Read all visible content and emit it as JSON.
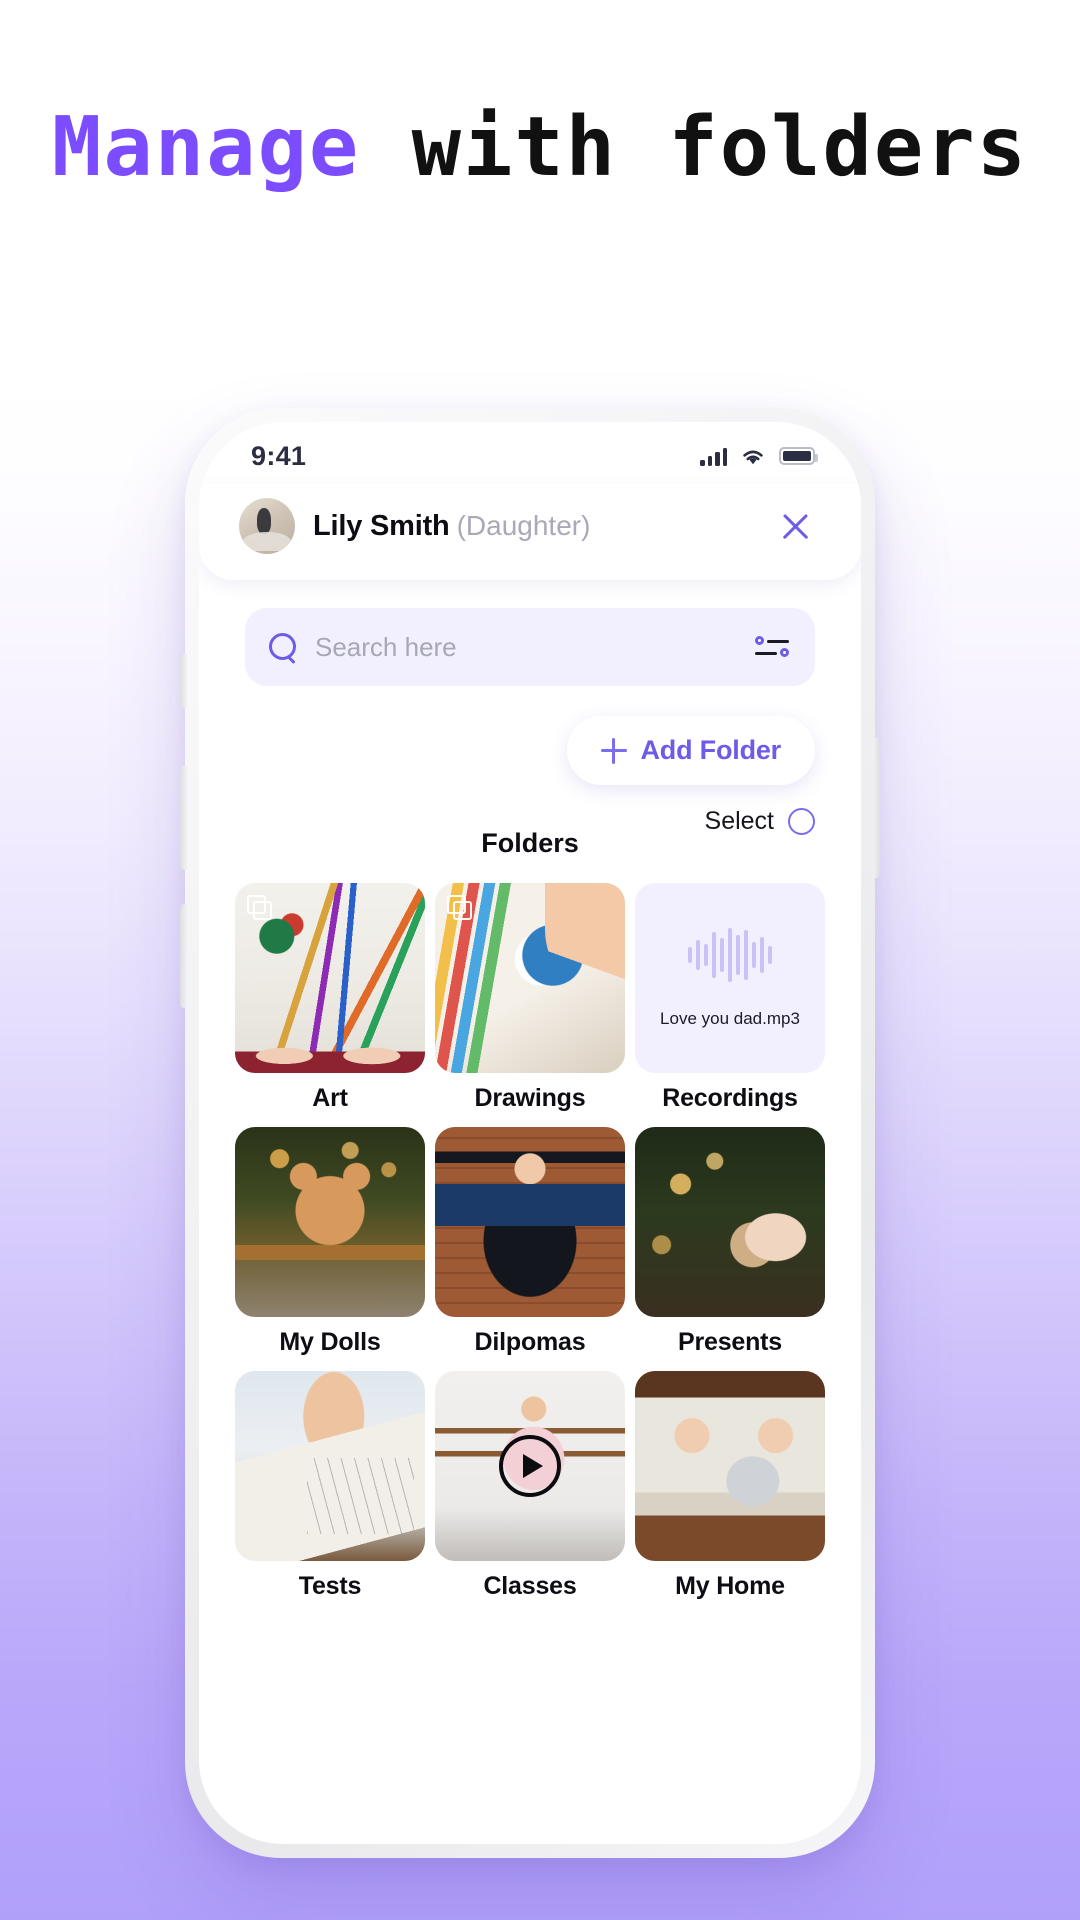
{
  "headline": {
    "part1": "Manage",
    "part2": "with folders",
    "accent_color": "#7C4DFF",
    "text_color": "#111111"
  },
  "phone": {
    "status_bar": {
      "time": "9:41",
      "icons": [
        "signal-icon",
        "wifi-icon",
        "battery-icon"
      ]
    },
    "profile": {
      "name": "Lily Smith",
      "relation": "(Daughter)",
      "avatar": "avatar-image",
      "close_icon": "close-icon"
    },
    "search": {
      "placeholder": "Search here",
      "value": "",
      "search_icon": "search-icon",
      "filter_icon": "filter-sliders-icon"
    },
    "add_folder": {
      "label": "Add Folder",
      "plus_icon": "plus-icon"
    },
    "select": {
      "label": "Select",
      "checkbox": "select-circle-checkbox"
    },
    "section_title": "Folders",
    "folders": [
      {
        "label": "Art",
        "thumb": "t-art",
        "badge": "stack-icon",
        "overlay": ""
      },
      {
        "label": "Drawings",
        "thumb": "t-draw",
        "badge": "stack-icon",
        "overlay": ""
      },
      {
        "label": "Recordings",
        "thumb": "t-rec",
        "badge": "",
        "overlay": "",
        "audio_name": "Love you dad.mp3",
        "waveform": "audio-waveform-icon"
      },
      {
        "label": "My Dolls",
        "thumb": "t-dolls",
        "badge": "",
        "overlay": ""
      },
      {
        "label": "Dilpomas",
        "thumb": "t-dip",
        "badge": "",
        "overlay": ""
      },
      {
        "label": "Presents",
        "thumb": "t-pres",
        "badge": "",
        "overlay": ""
      },
      {
        "label": "Tests",
        "thumb": "t-tests",
        "badge": "",
        "overlay": ""
      },
      {
        "label": "Classes",
        "thumb": "t-class",
        "badge": "",
        "overlay": "play-icon"
      },
      {
        "label": "My Home",
        "thumb": "t-home",
        "badge": "",
        "overlay": ""
      }
    ]
  },
  "colors": {
    "accent_purple": "#6C5CE7",
    "headline_purple": "#7C4DFF",
    "search_bg": "#F2F0FE",
    "bg_top": "#FFFFFF",
    "bg_bottom": "#B1A0FA"
  }
}
